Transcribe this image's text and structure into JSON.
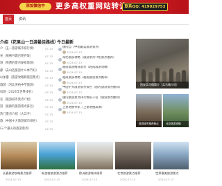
{
  "banner": {
    "badge_text": "添加微信中",
    "headline": "更多高权重网站转让",
    "contact": "联系QQ: 419029753",
    "colors": {
      "background": "#cc2229",
      "badge": "#f6d44a",
      "contact_bg": "#1f1f1f"
    }
  },
  "nav": {
    "home_label": "首页",
    "items": [
      "资讯"
    ]
  },
  "left": {
    "title": "介绍（花果山一日游最佳路线）",
    "rows": [
      {
        "title": "介（五一旅游城市排行榜）",
        "date": "07-13"
      },
      {
        "title": "光（张掖丹霞百花齐放）",
        "date": "07-13"
      },
      {
        "title": "游（免费的景点安排旅游）",
        "date": "07-13"
      },
      {
        "title": "都（去山西旅游什么季节好）",
        "date": "07-13"
      },
      {
        "title": "以加鲁（旅游攻略和旅游景点）",
        "date": "07-13"
      },
      {
        "title": "旅游（河北天桥中学旅游）",
        "date": "07-13"
      },
      {
        "title": "叫游（2024年世界排名）",
        "date": "07-13"
      },
      {
        "title": "名（旅游城市景点介绍）",
        "date": "07-13"
      },
      {
        "title": "游（张掖的旅游景点排名）",
        "date": "07-13"
      },
      {
        "title": "热门景点介绍（大口子）",
        "date": "07-13"
      },
      {
        "title": "旅（中国十大旅游城市排名）",
        "date": "07-13"
      },
      {
        "title": "(三个最火的旅游景点)",
        "date": "07-13"
      }
    ]
  },
  "mid": {
    "title": "今日最新",
    "items": [
      {
        "title": "国内自（中国最美旅游景点）",
        "date": "2024-07-13"
      },
      {
        "title": "海比旅游攻略（旅游景点介绍景点推荐）",
        "date": "2024-07-13"
      },
      {
        "title": "越南旅游推荐景点（越南旅游攻略）",
        "date": "2024-07-13"
      },
      {
        "title": "越南旅游攻略（越南旅游景点推荐）",
        "date": "2024-07-13"
      },
      {
        "title": "中国十大旅游景点排名（国内旅游景点推荐）",
        "date": "2024-07-13"
      },
      {
        "title": "国内旅游景点排行榜前十名（旅游景点推荐）",
        "date": "2024-07-13"
      },
      {
        "title": "卫星地图导航（卫星地图高清）",
        "date": "2024-07-13"
      }
    ]
  },
  "hero": {
    "caption": "西安兵马俑简介（兵马俑介绍）"
  },
  "thumbs": [
    {
      "caption": "旅游城市推荐景点"
    },
    {
      "caption": "北京旅游攻略"
    }
  ],
  "bottom": [
    {
      "caption": "长春旅游攻略景点推荐",
      "date": "2024-07-13"
    },
    {
      "caption": "新加坡旅游景点推荐",
      "date": "2024-07-13"
    },
    {
      "caption": "欧洲旅游城市推荐",
      "date": "2024-07-13"
    },
    {
      "caption": "北京旅游景点推荐",
      "date": "2024-07-13"
    },
    {
      "caption": "世界最美旅游景点",
      "date": "2024-07-13"
    }
  ]
}
